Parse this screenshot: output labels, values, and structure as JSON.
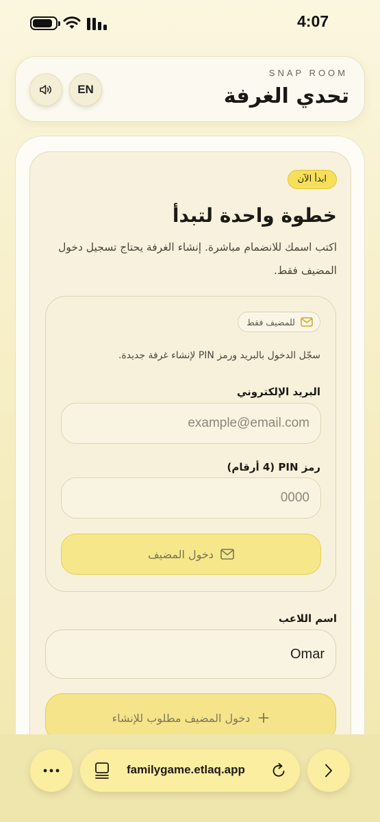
{
  "status_bar": {
    "time": "4:07"
  },
  "header": {
    "brand": "SNAP ROOM",
    "title": "تحدي الغرفة",
    "lang_label": "EN",
    "sound_icon": "speaker-icon"
  },
  "main": {
    "badge": "ابدأ الآن",
    "headline": "خطوة واحدة لتبدأ",
    "lead": "اكتب اسمك للانضمام مباشرة. إنشاء الغرفة يحتاج تسجيل دخول المضيف فقط."
  },
  "host": {
    "pill_label": "للمضيف فقط",
    "description": "سجّل الدخول بالبريد ورمز PIN لإنشاء غرفة جديدة.",
    "email_label": "البريد الإلكتروني",
    "email_placeholder": "example@email.com",
    "email_value": "",
    "pin_label": "رمز PIN (4 أرقام)",
    "pin_placeholder": "0000",
    "pin_value": "",
    "login_button": "دخول المضيف"
  },
  "player": {
    "label": "اسم اللاعب",
    "value": "Omar"
  },
  "create_button": "دخول المضيف مطلوب للإنشاء",
  "browser": {
    "url": "familygame.etlaq.app"
  },
  "colors": {
    "accent": "#F6DF5A",
    "button": "#F6E78B",
    "background": "#F7F1DD"
  }
}
